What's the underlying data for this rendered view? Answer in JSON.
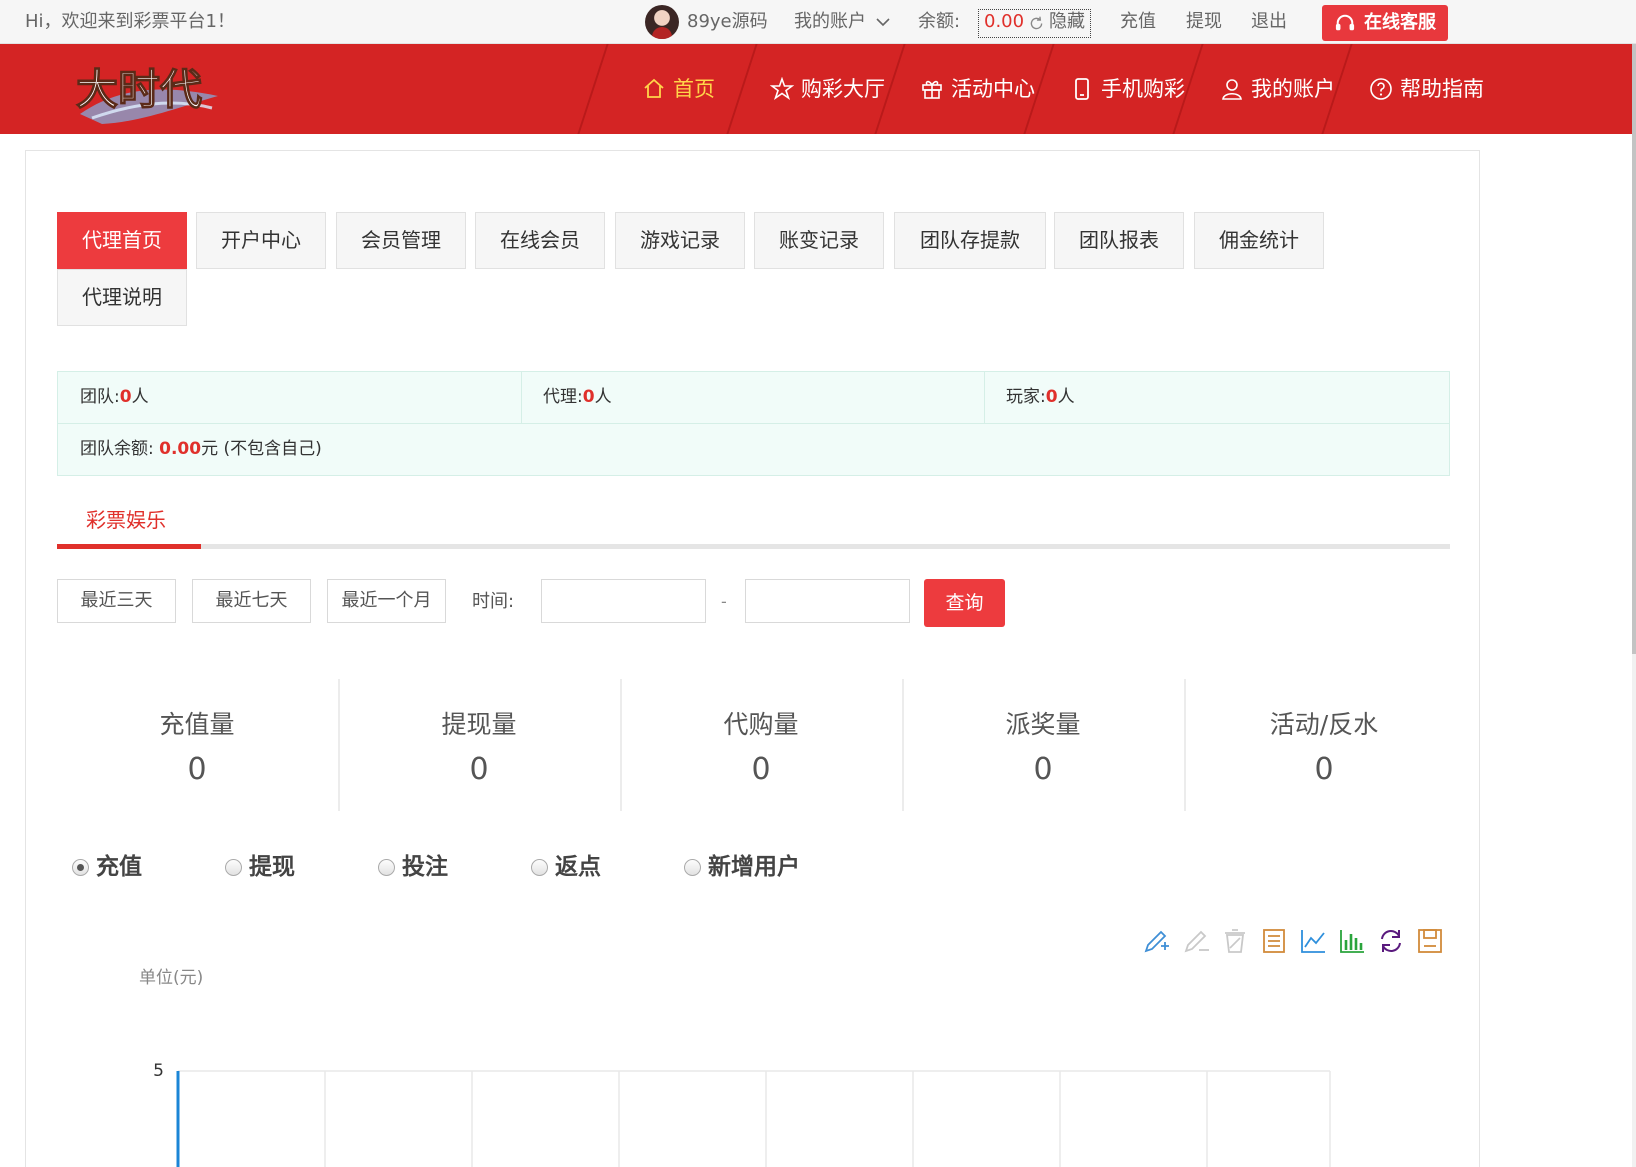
{
  "topbar": {
    "welcome": "Hi，欢迎来到彩票平台1！",
    "username": "89ye源码",
    "my_account": "我的账户",
    "balance_label": "余额:",
    "balance_value": "0.00",
    "hide": "隐藏",
    "recharge": "充值",
    "withdraw": "提现",
    "logout": "退出",
    "service": "在线客服"
  },
  "nav": {
    "logo_text": "大时代",
    "items": [
      {
        "label": "首页",
        "icon": "home-icon",
        "active": true
      },
      {
        "label": "购彩大厅",
        "icon": "star-icon"
      },
      {
        "label": "活动中心",
        "icon": "gift-icon"
      },
      {
        "label": "手机购彩",
        "icon": "mobile-icon"
      },
      {
        "label": "我的账户",
        "icon": "user-icon"
      },
      {
        "label": "帮助指南",
        "icon": "question-icon"
      }
    ]
  },
  "tabs": [
    "代理首页",
    "开户中心",
    "会员管理",
    "在线会员",
    "游戏记录",
    "账变记录",
    "团队存提款",
    "团队报表",
    "佣金统计",
    "代理说明"
  ],
  "stats": {
    "team_label": "团队:",
    "team_count": "0",
    "agent_label": "代理:",
    "agent_count": "0",
    "player_label": "玩家:",
    "player_count": "0",
    "person_unit": "人",
    "balance_label": "团队余额:",
    "balance_value": "0.00",
    "balance_suffix": "元 (不包含自己)"
  },
  "subtab": "彩票娱乐",
  "filters": {
    "range_buttons": [
      "最近三天",
      "最近七天",
      "最近一个月"
    ],
    "time_label": "时间:",
    "start_date": "",
    "end_date": "",
    "separator": "-",
    "query": "查询"
  },
  "metrics": [
    {
      "label": "充值量",
      "value": "0"
    },
    {
      "label": "提现量",
      "value": "0"
    },
    {
      "label": "代购量",
      "value": "0"
    },
    {
      "label": "派奖量",
      "value": "0"
    },
    {
      "label": "活动/反水",
      "value": "0"
    }
  ],
  "chart_types": [
    {
      "label": "充值",
      "selected": true
    },
    {
      "label": "提现",
      "selected": false
    },
    {
      "label": "投注",
      "selected": false
    },
    {
      "label": "返点",
      "selected": false
    },
    {
      "label": "新增用户",
      "selected": false
    }
  ],
  "toolbox": [
    "mark-icon",
    "mark-undo-icon",
    "mark-clear-icon",
    "data-view-icon",
    "line-chart-icon",
    "bar-chart-icon",
    "restore-icon",
    "save-image-icon"
  ],
  "colors": {
    "brand_red": "#d42424",
    "accent_red": "#ed3b3e",
    "active_nav": "#ffd54a",
    "stats_bg": "#f1fcf9",
    "axis_blue": "#1b85d6"
  },
  "chart_data": {
    "type": "line",
    "ylabel": "单位(元)",
    "y_ticks": [
      "5"
    ],
    "series": [
      {
        "values": []
      }
    ]
  }
}
